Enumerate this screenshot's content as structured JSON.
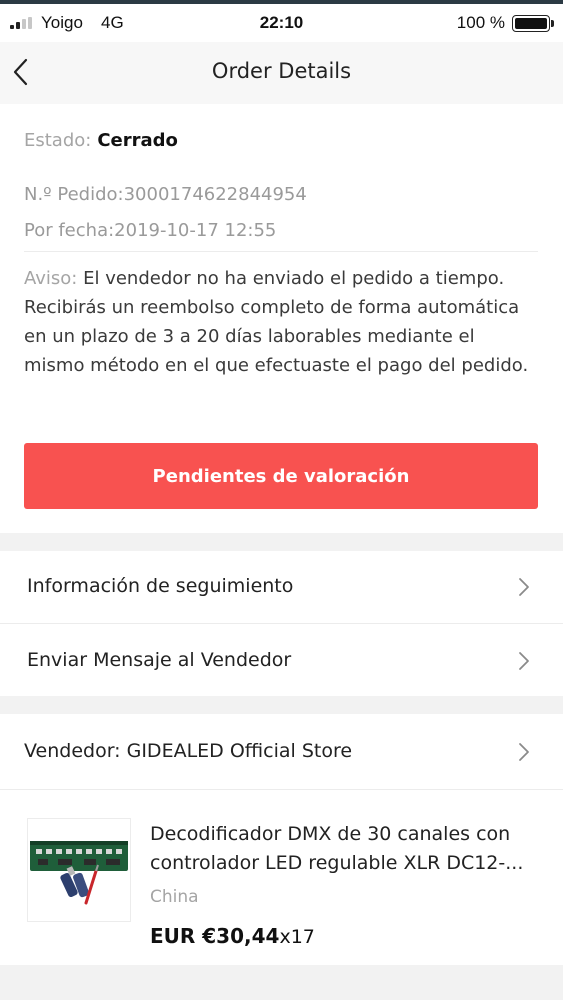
{
  "status_bar": {
    "carrier": "Yoigo",
    "network": "4G",
    "time": "22:10",
    "battery": "100 %"
  },
  "nav": {
    "title": "Order Details",
    "back_icon": "chevron-left-icon"
  },
  "order": {
    "state_label": "Estado:",
    "state_value": "Cerrado",
    "order_number": "N.º Pedido:3000174622844954",
    "order_date": "Por fecha:2019-10-17 12:55",
    "notice_label": "Aviso:",
    "notice_text": " El vendedor no ha enviado el pedido a tiempo. Recibirás un reembolso completo de forma automática en un plazo de 3 a 20 días laborables mediante el mismo método en el que efectuaste el pago del pedido."
  },
  "actions": {
    "review_button": "Pendientes de valoración"
  },
  "links": {
    "tracking": "Información de seguimiento",
    "message_seller": "Enviar Mensaje al Vendedor",
    "seller_store": "Vendedor: GIDEALED Official Store"
  },
  "product": {
    "title": "Decodificador DMX de 30 canales con controlador LED regulable XLR DC12-...",
    "origin": "China",
    "price": "EUR €30,44",
    "quantity": "x17"
  },
  "colors": {
    "accent": "#f85250",
    "background_gap": "#f2f2f2"
  }
}
